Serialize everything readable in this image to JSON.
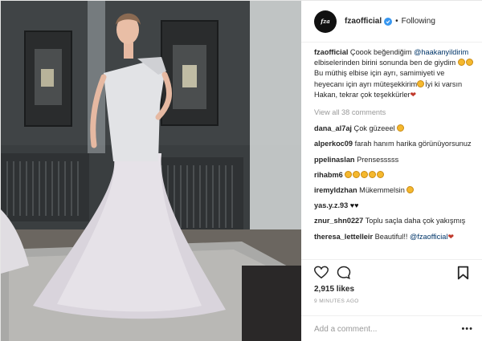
{
  "post": {
    "username": "fzaofficial",
    "follow_status": "Following",
    "separator": "•",
    "avatar_text": "fza"
  },
  "caption": {
    "user": "fzaofficial",
    "text_1": " Çoook beğendiğim ",
    "mention": "@haakanyildirim",
    "text_2": " elbiselerinden birini sonunda ben de giydim",
    "text_3": " Bu müthiş elbise için ayrı, samimiyeti ve heyecanı için ayrı müteşekkirim",
    "text_4": "İyi ki varsın Hakan, tekrar çok teşekkürler"
  },
  "view_all_comments": "View all 38 comments",
  "comments": [
    {
      "user": "dana_al7aj",
      "text": " Çok güzeeel"
    },
    {
      "user": "alperkoc09",
      "text": " farah hanım harika görünüyorsunuz"
    },
    {
      "user": "ppelinaslan",
      "text": " Prensesssss"
    },
    {
      "user": "rihabm6",
      "text": " "
    },
    {
      "user": "iremyldzhan",
      "text": " Mükemmelsin"
    },
    {
      "user": "yas.y.z.93",
      "text": " "
    },
    {
      "user": "znur_shn0227",
      "text": " Toplu saçla daha çok yakışmış"
    },
    {
      "user": "theresa_lettelleir",
      "text": " Beautiful!! ",
      "mention": "@fzaofficial"
    }
  ],
  "likes": "2,915 likes",
  "time_ago": "9 MINUTES AGO",
  "add_comment_placeholder": "Add a comment...",
  "more_label": "•••",
  "icons": {
    "verified": "verified-badge-icon",
    "like": "heart-outline-icon",
    "comment": "speech-bubble-icon",
    "save": "bookmark-icon"
  },
  "colors": {
    "verified_blue": "#3897f0",
    "mention": "#003569",
    "muted": "#999999",
    "text": "#262626"
  }
}
